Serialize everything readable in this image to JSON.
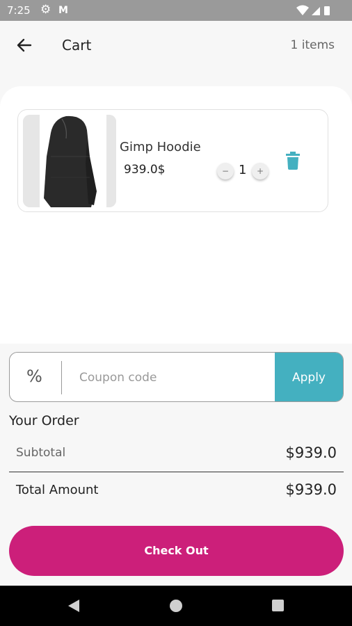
{
  "status_bar": {
    "time": "7:25",
    "icons": [
      "settings-icon",
      "gmail-icon",
      "wifi-icon",
      "signal-icon",
      "battery-icon"
    ]
  },
  "header": {
    "back_icon": "arrow-left-icon",
    "title": "Cart",
    "item_count": "1 items"
  },
  "cart": {
    "items": [
      {
        "name": "Gimp Hoodie",
        "price": "939.0$",
        "quantity": "1",
        "minus_label": "−",
        "plus_label": "+",
        "delete_icon": "trash-icon"
      }
    ]
  },
  "coupon": {
    "icon": "%",
    "placeholder": "Coupon code",
    "value": "",
    "apply_label": "Apply"
  },
  "order": {
    "title": "Your Order",
    "subtotal_label": "Subtotal",
    "subtotal_value": "$939.0",
    "total_label": "Total Amount",
    "total_value": "$939.0"
  },
  "checkout": {
    "label": "Check Out"
  },
  "nav_bar": {
    "icons": [
      "nav-back-icon",
      "nav-home-icon",
      "nav-recents-icon"
    ]
  },
  "colors": {
    "accent": "#44b0c0",
    "checkout": "#cc1f7a",
    "trash": "#44b0c0",
    "background": "#f7f7f7"
  }
}
